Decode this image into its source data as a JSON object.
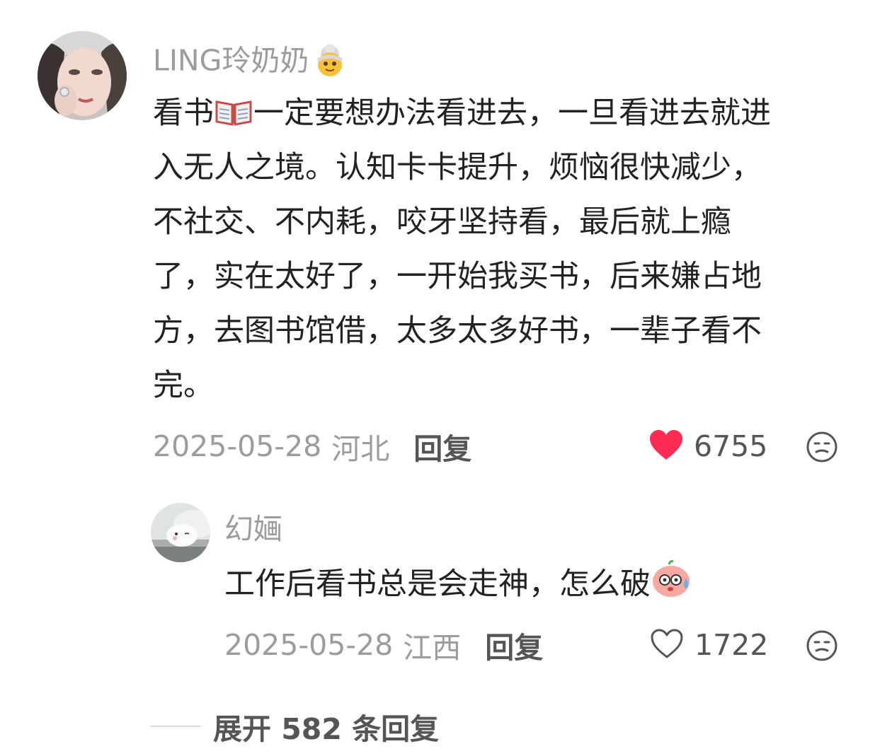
{
  "comment": {
    "username": "LING玲奶奶",
    "username_emoji": "older-woman-emoji",
    "text_lines": [
      "看书",
      "一定要想办法看进去，一旦看进去就进",
      "入无人之境。认知卡卡提升，烦恼很快减少，",
      "不社交、不内耗，咬牙坚持看，最后就上瘾",
      "了，实在太好了，一开始我买书，后来嫌占地",
      "方，去图书馆借，太多太多好书，一辈子看不",
      "完。"
    ],
    "inline_emoji": "open-book-emoji",
    "date": "2025-05-28",
    "location": "河北",
    "reply_label": "回复",
    "likes": "6755",
    "liked": true,
    "like_color": "#fe2c55"
  },
  "reply": {
    "username": "幻婳",
    "text": "工作后看书总是会走神，怎么破",
    "trailing_emoji": "sweating-face-emoji",
    "date": "2025-05-28",
    "location": "江西",
    "reply_label": "回复",
    "likes": "1722",
    "liked": false
  },
  "expand": {
    "label": "展开 582 条回复"
  },
  "colors": {
    "username": "#9c9c9c",
    "body_text": "#222222",
    "meta_text": "#9c9c9c",
    "action_text": "#555555"
  }
}
